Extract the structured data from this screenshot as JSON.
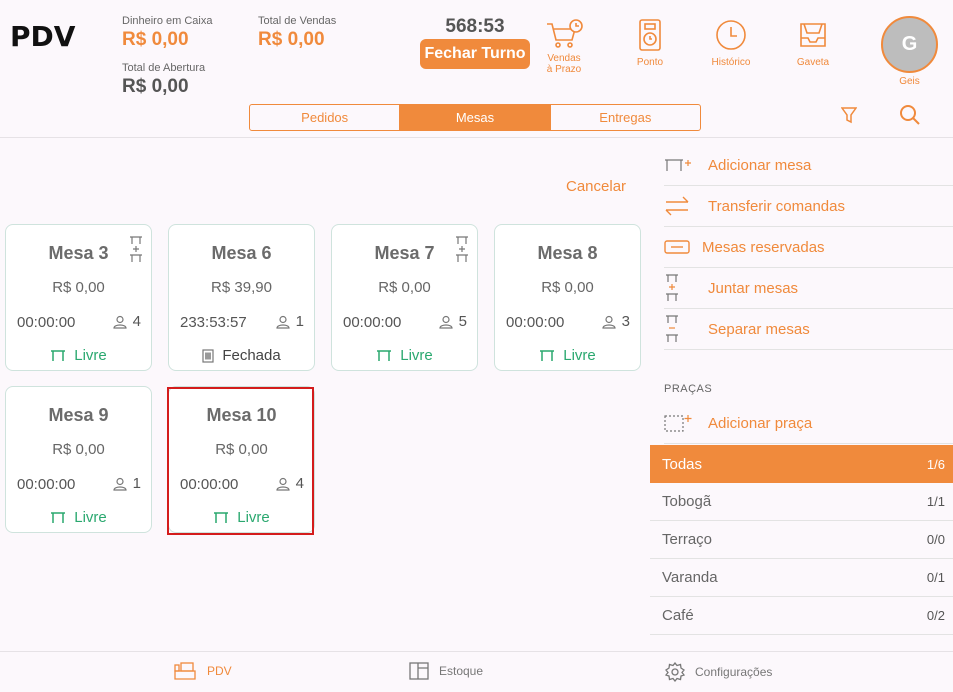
{
  "app": {
    "title": "PDV"
  },
  "header": {
    "dinheiro_label": "Dinheiro em Caixa",
    "dinheiro_value": "R$ 0,00",
    "total_vendas_label": "Total de Vendas",
    "total_vendas_value": "R$ 0,00",
    "abertura_label": "Total de Abertura",
    "abertura_value": "R$ 0,00",
    "timer": "568:53",
    "fechar_turno": "Fechar Turno",
    "icons": {
      "vendas_line1": "Vendas",
      "vendas_line2": "à Prazo",
      "ponto": "Ponto",
      "historico": "Histórico",
      "gaveta": "Gaveta"
    },
    "user": {
      "initial": "G",
      "name": "Geis"
    }
  },
  "tabs": [
    "Pedidos",
    "Mesas",
    "Entregas"
  ],
  "active_tab": "Mesas",
  "main": {
    "cancel_label": "Cancelar",
    "tables": [
      {
        "name": "Mesa 3",
        "value": "R$ 0,00",
        "time": "00:00:00",
        "guests": "4",
        "status": "Livre",
        "joined": true
      },
      {
        "name": "Mesa 6",
        "value": "R$ 39,90",
        "time": "233:53:57",
        "guests": "1",
        "status": "Fechada",
        "joined": false
      },
      {
        "name": "Mesa 7",
        "value": "R$ 0,00",
        "time": "00:00:00",
        "guests": "5",
        "status": "Livre",
        "joined": true
      },
      {
        "name": "Mesa 8",
        "value": "R$ 0,00",
        "time": "00:00:00",
        "guests": "3",
        "status": "Livre",
        "joined": false
      },
      {
        "name": "Mesa 9",
        "value": "R$ 0,00",
        "time": "00:00:00",
        "guests": "1",
        "status": "Livre",
        "joined": false
      },
      {
        "name": "Mesa 10",
        "value": "R$ 0,00",
        "time": "00:00:00",
        "guests": "4",
        "status": "Livre",
        "joined": false,
        "selected": true
      }
    ]
  },
  "panel": {
    "actions": [
      {
        "icon": "add-table-icon",
        "label": "Adicionar mesa"
      },
      {
        "icon": "transfer-icon",
        "label": "Transferir comandas"
      },
      {
        "icon": "reserved-icon",
        "label": "Mesas reservadas"
      },
      {
        "icon": "join-tables-icon",
        "label": "Juntar mesas"
      },
      {
        "icon": "split-tables-icon",
        "label": "Separar mesas"
      }
    ],
    "pracas_header": "PRAÇAS",
    "add_praca": "Adicionar praça",
    "pracas": [
      {
        "name": "Todas",
        "count": "1/6",
        "active": true
      },
      {
        "name": "Tobogã",
        "count": "1/1"
      },
      {
        "name": "Terraço",
        "count": "0/0"
      },
      {
        "name": "Varanda",
        "count": "0/1"
      },
      {
        "name": "Café",
        "count": "0/2"
      }
    ]
  },
  "bottom_nav": [
    {
      "icon": "pdv-icon",
      "label": "PDV",
      "active": true
    },
    {
      "icon": "estoque-icon",
      "label": "Estoque"
    },
    {
      "icon": "settings-icon",
      "label": "Configurações"
    }
  ],
  "colors": {
    "accent": "#f08a3c",
    "livre": "#2aa86f",
    "selection": "#d41c1c"
  }
}
